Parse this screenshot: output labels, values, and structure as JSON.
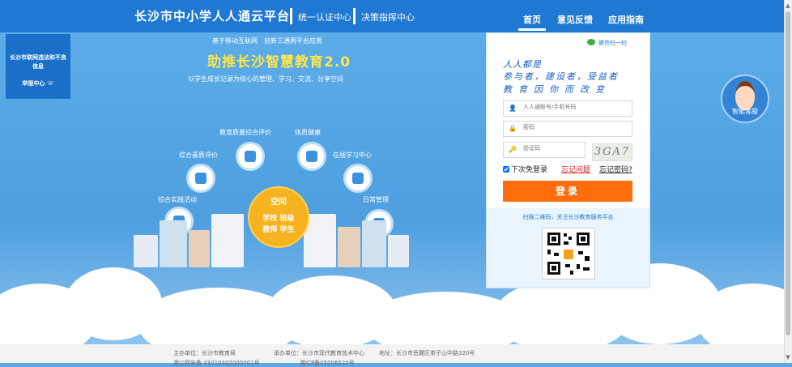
{
  "header": {
    "brand": "长沙市中小学人人通云平台",
    "links": [
      "统一认证中心",
      "决策指挥中心"
    ],
    "nav": [
      "首页",
      "意见反馈",
      "应用指南"
    ]
  },
  "report": {
    "text": "长沙市联网违法和不良信息",
    "link": "举报中心"
  },
  "hero": {
    "slogan_top": "基于移动互联网　创新三通两平台应用",
    "slogan_main": "助推长沙智慧教育2.0",
    "slogan_sub": "以学生成长记录为核心的管理、学习、交流、分享空间",
    "features": [
      "教育质量综合评价",
      "体质健康",
      "综合素质评价",
      "在线学习中心",
      "综合实践活动",
      "日常管理"
    ],
    "center": {
      "title": "空间",
      "items": [
        "学校",
        "班级",
        "教师",
        "学生"
      ]
    }
  },
  "login": {
    "wechat": "微信扫一扫",
    "handwriting": [
      "人人都是",
      "参与者，建设者，受益者",
      "教育因你而改变"
    ],
    "account_placeholder": "人人通账号/手机号码",
    "password_placeholder": "密码",
    "captcha_placeholder": "验证码",
    "captcha_text": "3GA7",
    "remember": "下次免登录",
    "forgot_account": "忘记问题",
    "forgot_password": "忘记密码?",
    "submit": "登录",
    "qr_caption": "扫描二维码，关注长沙教育服务平台"
  },
  "service": {
    "label": "智能客服"
  },
  "footer": {
    "host": "主办单位：长沙市教育局",
    "undertaker": "承办单位：长沙市现代教育技术中心",
    "address": "地址：长沙市岳麓区茶子山中路320号",
    "icp1": "湘公网安备 43010402000001号",
    "icp2": "湘ICP备05006520号"
  }
}
